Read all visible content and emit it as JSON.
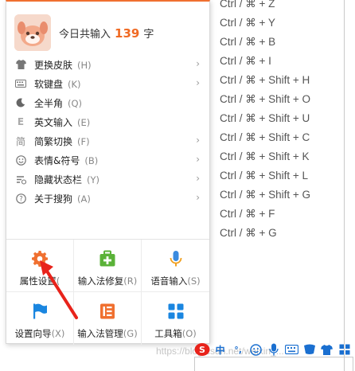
{
  "shortcuts": [
    "Ctrl / ⌘ + Z",
    "Ctrl / ⌘ + Y",
    "Ctrl / ⌘ + B",
    "Ctrl / ⌘ + I",
    "Ctrl / ⌘ + Shift + H",
    "Ctrl / ⌘ + Shift + O",
    "Ctrl / ⌘ + Shift + U",
    "Ctrl / ⌘ + Shift + C",
    "Ctrl / ⌘ + Shift + K",
    "Ctrl / ⌘ + Shift + L",
    "Ctrl / ⌘ + Shift + G",
    "Ctrl / ⌘ + F",
    "Ctrl / ⌘ + G"
  ],
  "popup": {
    "accent_color": "#f07030",
    "count_prefix": "今日共输入",
    "count_value": "139",
    "count_suffix": "字",
    "menu_items": [
      {
        "label": "更换皮肤",
        "key": "(H)",
        "icon": "shirt-icon",
        "has_arrow": true
      },
      {
        "label": "软键盘",
        "key": "(K)",
        "icon": "keyboard-icon",
        "has_arrow": true
      },
      {
        "label": "全半角",
        "key": "(Q)",
        "icon": "moon-icon",
        "has_arrow": false
      },
      {
        "label": "英文输入",
        "key": "(E)",
        "icon": "english-e-icon",
        "has_arrow": false
      },
      {
        "label": "简繁切换",
        "key": "(F)",
        "icon": "jian-char-icon",
        "has_arrow": true
      },
      {
        "label": "表情&符号",
        "key": "(B)",
        "icon": "smiley-icon",
        "has_arrow": true
      },
      {
        "label": "隐藏状态栏",
        "key": "(Y)",
        "icon": "hide-statusbar-icon",
        "has_arrow": true
      },
      {
        "label": "关于搜狗",
        "key": "(A)",
        "icon": "question-icon",
        "has_arrow": true
      }
    ],
    "grid_items": [
      {
        "label": "属性设置",
        "key": "(",
        "icon": "gear-icon",
        "color": "#f07030"
      },
      {
        "label": "输入法修复",
        "key": "(R)",
        "icon": "medkit-icon",
        "color": "#5ab238"
      },
      {
        "label": "语音输入",
        "key": "(S)",
        "icon": "microphone-icon",
        "color": "#3a8be0"
      },
      {
        "label": "设置向导",
        "key": "(X)",
        "icon": "flag-icon",
        "color": "#1a86e0"
      },
      {
        "label": "输入法管理",
        "key": "(G)",
        "icon": "manage-list-icon",
        "color": "#f07030"
      },
      {
        "label": "工具箱",
        "key": "(O)",
        "icon": "toolbox-grid-icon",
        "color": "#1a86e0"
      }
    ]
  },
  "taskbar": {
    "ime_mode": "中",
    "punct": "°,",
    "icons": [
      "sogou-s-icon",
      "smiley-icon",
      "microphone-icon",
      "keyboard-icon",
      "skin-icon",
      "shirt-icon",
      "grid-icon"
    ]
  },
  "watermark": "https://blog.csdn.net/weixin_..."
}
